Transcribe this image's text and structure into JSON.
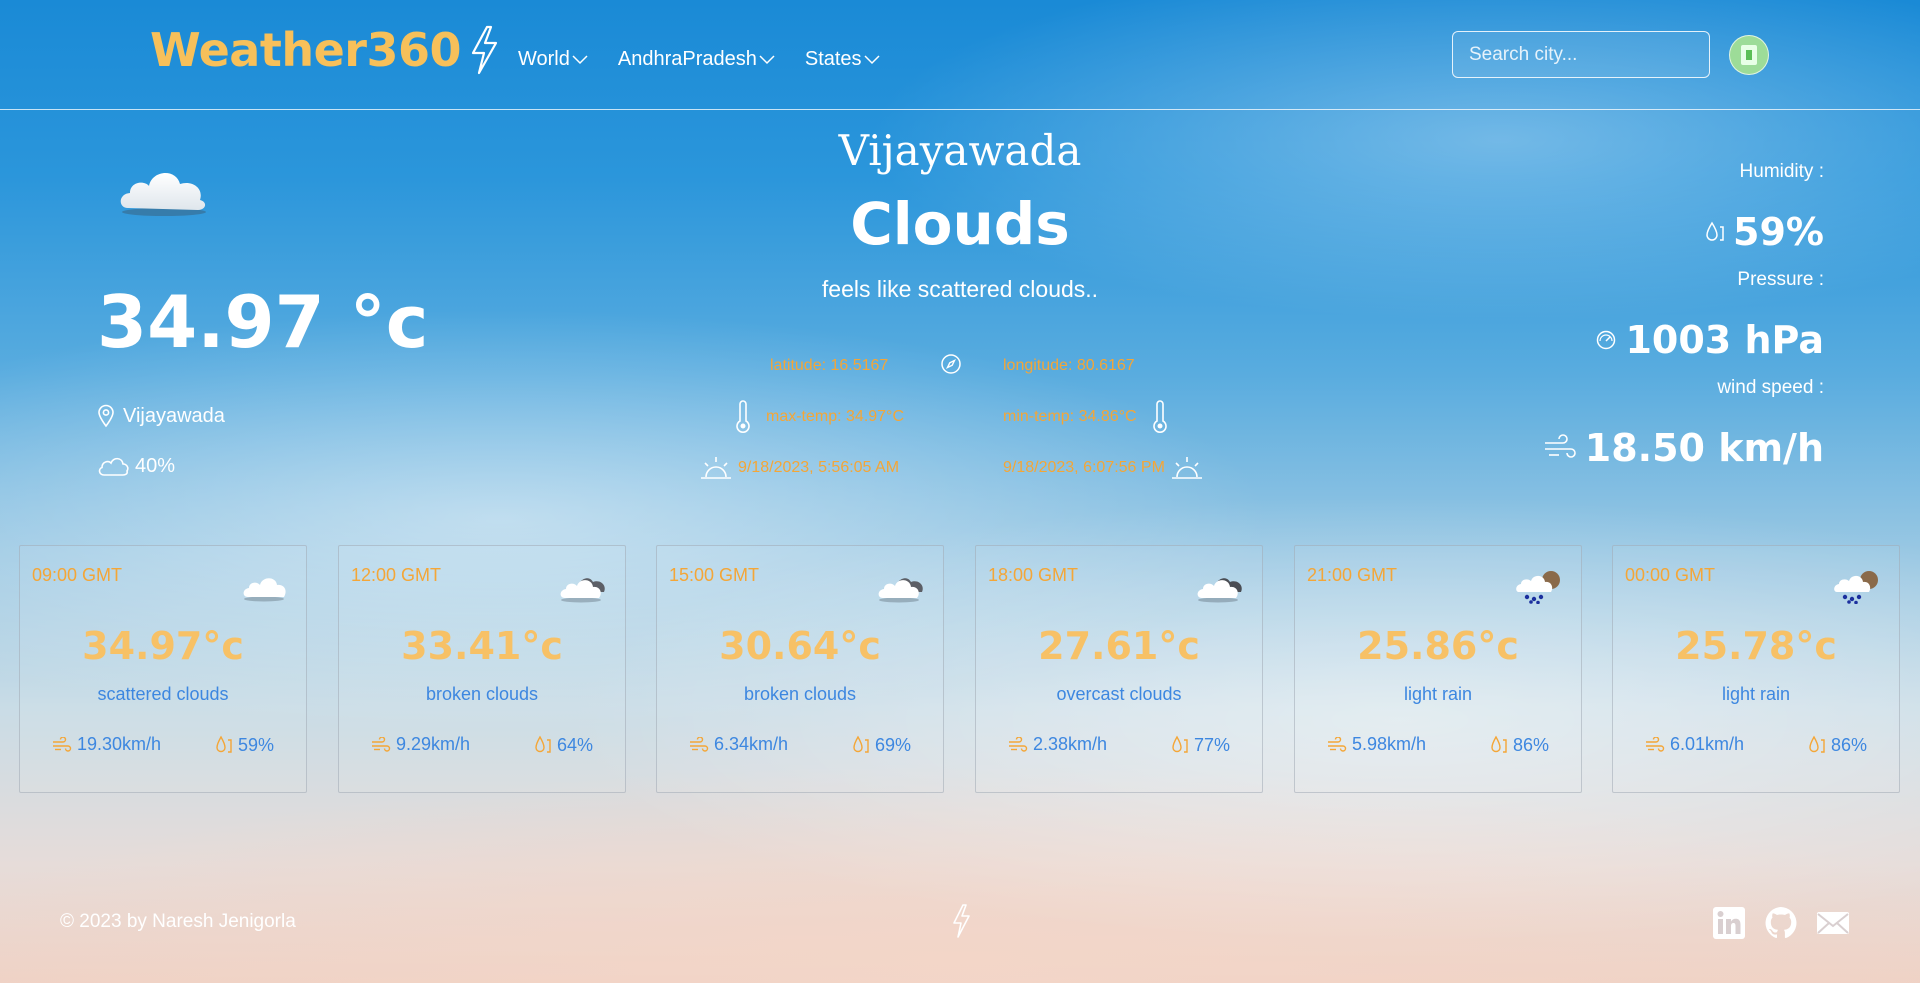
{
  "navbar": {
    "brand": "Weather360",
    "menu": [
      {
        "label": "World"
      },
      {
        "label": "AndhraPradesh"
      },
      {
        "label": "States"
      }
    ],
    "search_placeholder": "Search city..."
  },
  "current": {
    "city": "Vijayawada",
    "condition": "Clouds",
    "feels_like": "feels like scattered clouds..",
    "temperature": "34.97 °c",
    "location": "Vijayawada",
    "cloudiness": "40%",
    "latitude": "latitude: 16.5167",
    "longitude": "longitude: 80.6167",
    "max_temp": "max-temp: 34.97°C",
    "min_temp": "min-temp: 34.86°C",
    "sunrise": "9/18/2023, 5:56:05 AM",
    "sunset": "9/18/2023, 6:07:56 PM",
    "humidity_label": "Humidity :",
    "humidity": "59%",
    "pressure_label": "Pressure :",
    "pressure": "1003 hPa",
    "wind_label": "wind speed :",
    "wind": "18.50 km/h"
  },
  "forecast": [
    {
      "time": "09:00 GMT",
      "temp": "34.97°c",
      "desc": "scattered clouds",
      "wind": "19.30km/h",
      "humidity": "59%",
      "icon": "scattered-clouds-icon"
    },
    {
      "time": "12:00 GMT",
      "temp": "33.41°c",
      "desc": "broken clouds",
      "wind": "9.29km/h",
      "humidity": "64%",
      "icon": "broken-clouds-icon"
    },
    {
      "time": "15:00 GMT",
      "temp": "30.64°c",
      "desc": "broken clouds",
      "wind": "6.34km/h",
      "humidity": "69%",
      "icon": "broken-clouds-icon"
    },
    {
      "time": "18:00 GMT",
      "temp": "27.61°c",
      "desc": "overcast clouds",
      "wind": "2.38km/h",
      "humidity": "77%",
      "icon": "overcast-clouds-icon"
    },
    {
      "time": "21:00 GMT",
      "temp": "25.86°c",
      "desc": "light rain",
      "wind": "5.98km/h",
      "humidity": "86%",
      "icon": "light-rain-icon"
    },
    {
      "time": "00:00 GMT",
      "temp": "25.78°c",
      "desc": "light rain",
      "wind": "6.01km/h",
      "humidity": "86%",
      "icon": "light-rain-icon"
    }
  ],
  "footer": {
    "copyright": "© 2023 by Naresh Jenigorla"
  },
  "colors": {
    "brand": "#f7c05a",
    "accent_orange": "#f4a637",
    "card_temp": "#f7c166",
    "card_text_blue": "#3d87e0"
  }
}
